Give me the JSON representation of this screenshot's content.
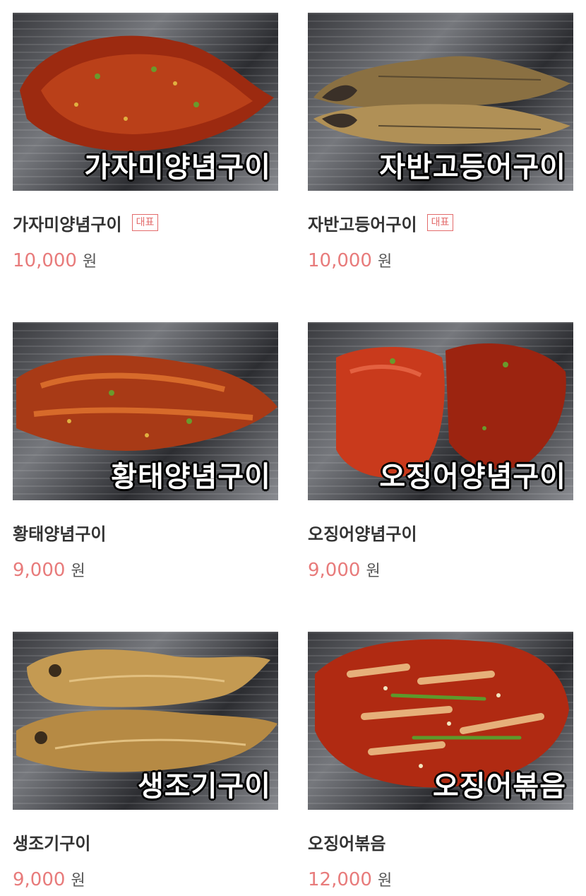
{
  "menu": {
    "items": [
      {
        "name": "가자미양념구이",
        "overlay": "가자미양념구이",
        "badge": "대표",
        "price": "10,000",
        "unit": "원",
        "food": "flatfish-seasoned"
      },
      {
        "name": "자반고등어구이",
        "overlay": "자반고등어구이",
        "badge": "대표",
        "price": "10,000",
        "unit": "원",
        "food": "mackerel-grilled"
      },
      {
        "name": "황태양념구이",
        "overlay": "황태양념구이",
        "badge": "",
        "price": "9,000",
        "unit": "원",
        "food": "pollack-seasoned"
      },
      {
        "name": "오징어양념구이",
        "overlay": "오징어양념구이",
        "badge": "",
        "price": "9,000",
        "unit": "원",
        "food": "squid-seasoned"
      },
      {
        "name": "생조기구이",
        "overlay": "생조기구이",
        "badge": "",
        "price": "9,000",
        "unit": "원",
        "food": "croaker-grilled"
      },
      {
        "name": "오징어볶음",
        "overlay": "오징어볶음",
        "badge": "",
        "price": "12,000",
        "unit": "원",
        "food": "squid-stirfry"
      }
    ]
  }
}
